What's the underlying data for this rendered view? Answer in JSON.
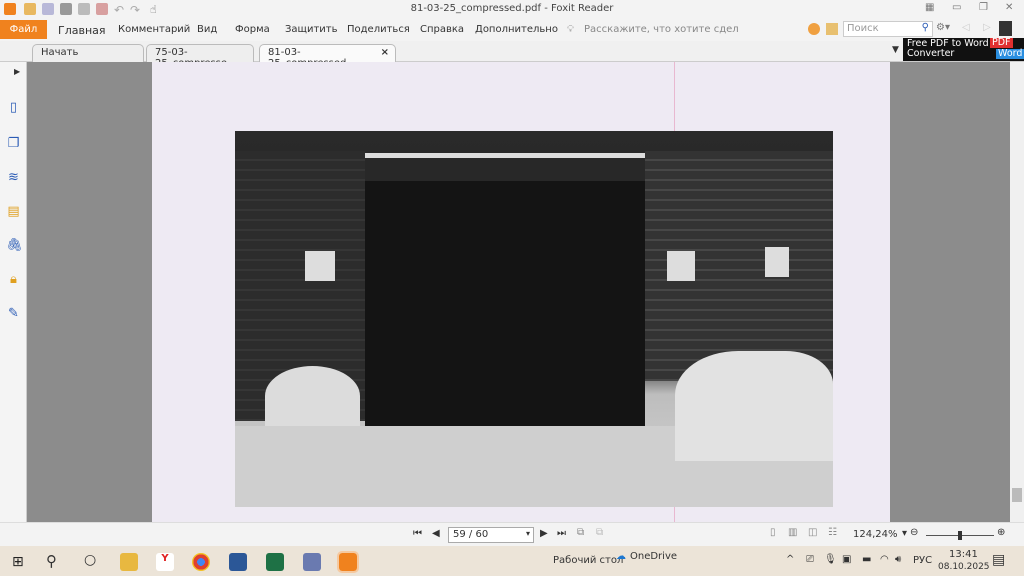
{
  "window": {
    "title": "81-03-25_compressed.pdf - Foxit Reader"
  },
  "menu": {
    "file": "Файл",
    "items": [
      "Главная",
      "Комментарий",
      "Вид",
      "Форма",
      "Защитить",
      "Поделиться",
      "Справка",
      "Дополнительно"
    ],
    "tell_me": "Расскажите, что хотите сдел",
    "search_placeholder": "Поиск"
  },
  "ad": {
    "line1": "Free PDF to Word",
    "line2": "Converter",
    "badge1": "PDF",
    "badge2": "Word"
  },
  "tabs": [
    {
      "label": "Начать"
    },
    {
      "label": "75-03-25_compresse..."
    },
    {
      "label": "81-03-25_compressed....",
      "active": true,
      "close": "×"
    }
  ],
  "nav": {
    "page_value": "59 / 60",
    "zoom": "124,24%"
  },
  "taskbar": {
    "desktop": "Рабочий стол",
    "onedrive": "OneDrive",
    "lang": "РУС",
    "time": "13:41",
    "date": "08.10.2025"
  },
  "colors": {
    "accent": "#f0821e"
  }
}
